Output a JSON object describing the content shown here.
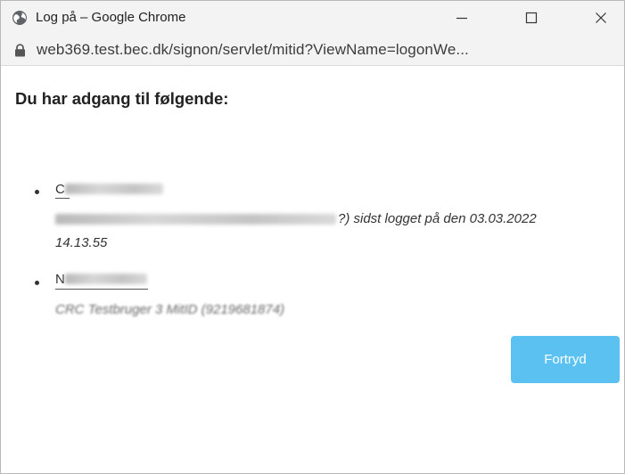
{
  "window": {
    "title": "Log på – Google Chrome",
    "url": "web369.test.bec.dk/signon/servlet/mitid?ViewName=logonWe..."
  },
  "main": {
    "heading": "Du har adgang til følgende:",
    "accounts": [
      {
        "name_initial": "C",
        "description_suffix": "?) sidst logget på den 03.03.2022",
        "time": "14.13.55"
      },
      {
        "name_initial": "N",
        "description_obscured": "CRC Testbruger 3 MitID (9219681874)"
      }
    ],
    "cancel_label": "Fortryd"
  },
  "colors": {
    "accent_button": "#5bc1f0",
    "titlebar_bg": "#f3f3f3"
  },
  "icons": {
    "app": "chrome-globe-icon",
    "lock": "lock-icon",
    "minimize": "minimize-icon",
    "maximize": "maximize-icon",
    "close": "close-icon"
  }
}
